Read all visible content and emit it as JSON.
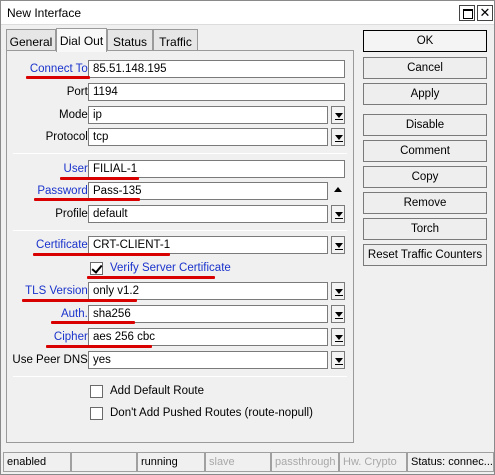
{
  "window": {
    "title": "New Interface"
  },
  "tabs": [
    {
      "label": "General"
    },
    {
      "label": "Dial Out"
    },
    {
      "label": "Status"
    },
    {
      "label": "Traffic"
    }
  ],
  "form": {
    "connect_to": {
      "label": "Connect To:",
      "value": "85.51.148.195"
    },
    "port": {
      "label": "Port:",
      "value": "1194"
    },
    "mode": {
      "label": "Mode:",
      "value": "ip"
    },
    "protocol": {
      "label": "Protocol:",
      "value": "tcp"
    },
    "user": {
      "label": "User:",
      "value": "FILIAL-1"
    },
    "password": {
      "label": "Password:",
      "value": "Pass-135"
    },
    "profile": {
      "label": "Profile:",
      "value": "default"
    },
    "certificate": {
      "label": "Certificate:",
      "value": "CRT-CLIENT-1"
    },
    "verify_server_certificate": {
      "label": "Verify Server Certificate",
      "checked": true
    },
    "tls_version": {
      "label": "TLS Version:",
      "value": "only v1.2"
    },
    "auth": {
      "label": "Auth.:",
      "value": "sha256"
    },
    "cipher": {
      "label": "Cipher:",
      "value": "aes 256 cbc"
    },
    "use_peer_dns": {
      "label": "Use Peer DNS:",
      "value": "yes"
    },
    "add_default_route": {
      "label": "Add Default Route",
      "checked": false
    },
    "dont_add_pushed_routes": {
      "label": "Don't Add Pushed Routes (route-nopull)",
      "checked": false
    }
  },
  "buttons": {
    "ok": "OK",
    "cancel": "Cancel",
    "apply": "Apply",
    "disable": "Disable",
    "comment": "Comment",
    "copy": "Copy",
    "remove": "Remove",
    "torch": "Torch",
    "reset_traffic_counters": "Reset Traffic Counters"
  },
  "statusbar": {
    "enabled": "enabled",
    "running": "running",
    "slave": "slave",
    "passthrough": "passthrough",
    "hw_crypto": "Hw. Crypto",
    "status": "Status: connec..."
  },
  "colors": {
    "highlight_underline": "#d90000",
    "link_label": "#1a33cc"
  }
}
